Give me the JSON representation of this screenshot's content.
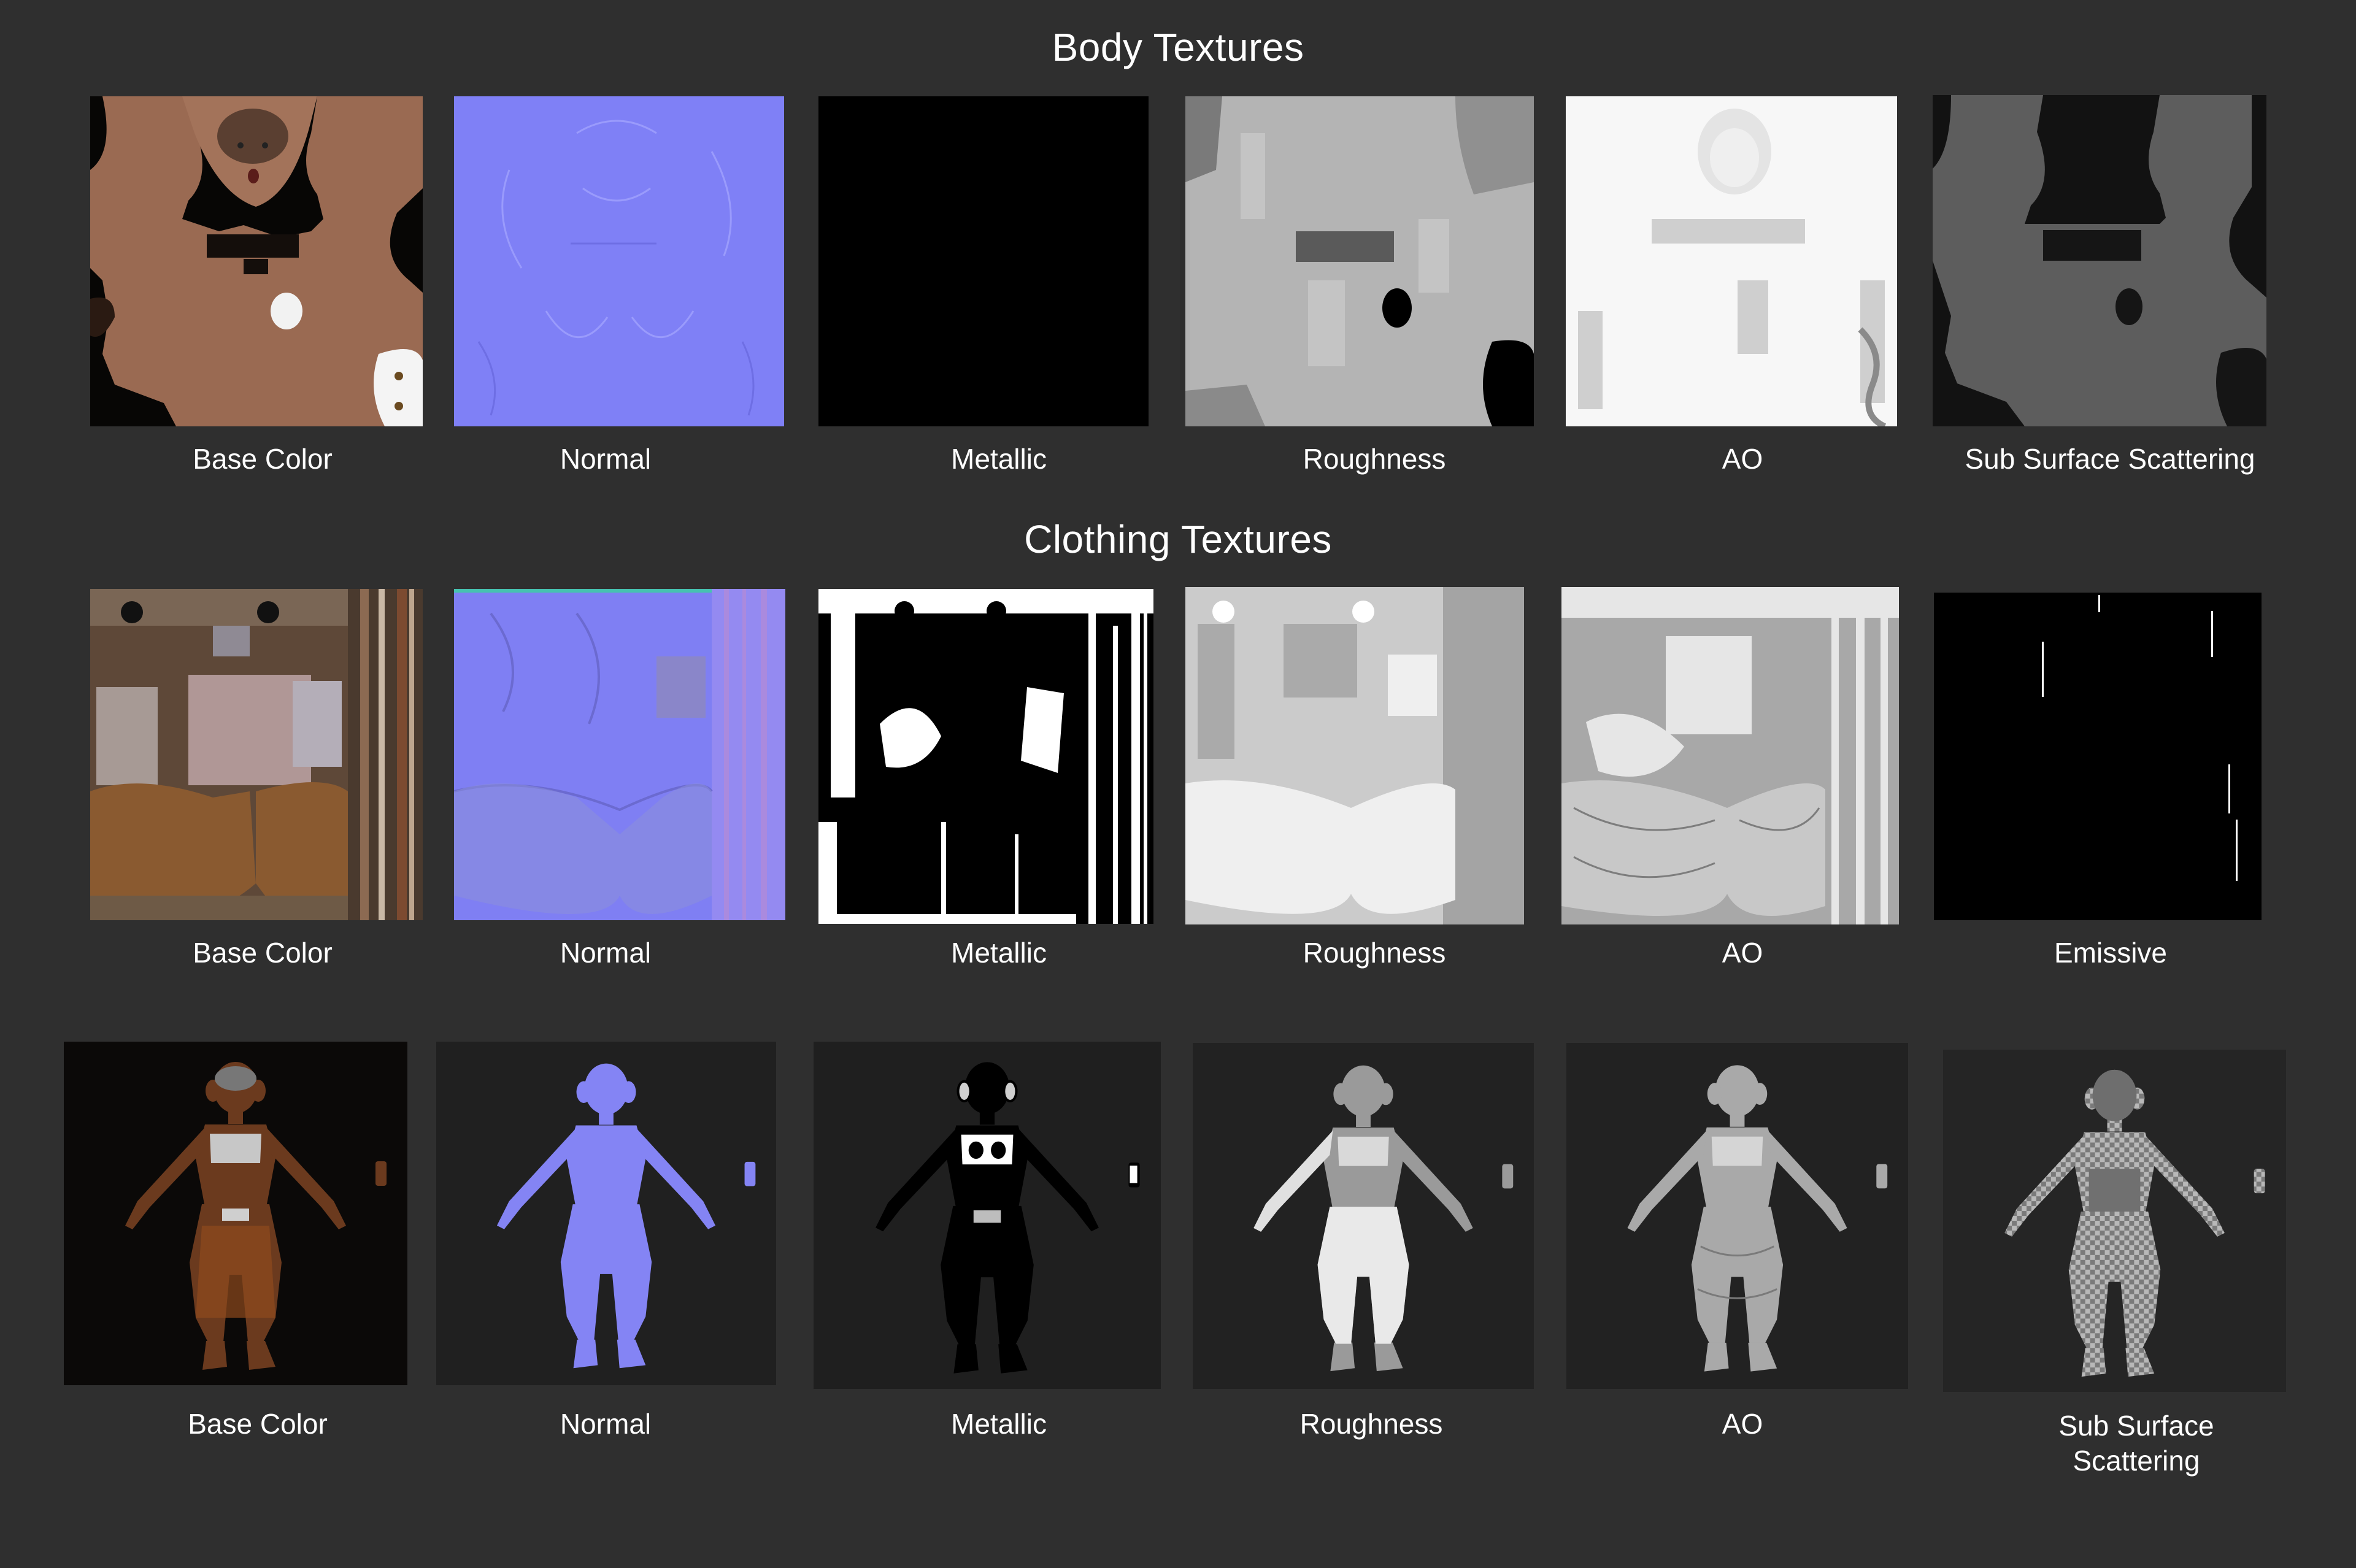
{
  "sections": {
    "body_title": "Body Textures",
    "clothing_title": "Clothing Textures"
  },
  "body_maps": [
    {
      "label": "Base Color",
      "kind": "body-base-color"
    },
    {
      "label": "Normal",
      "kind": "normal-map"
    },
    {
      "label": "Metallic",
      "kind": "black-map"
    },
    {
      "label": "Roughness",
      "kind": "grey-map"
    },
    {
      "label": "AO",
      "kind": "white-map"
    },
    {
      "label": "Sub Surface Scattering",
      "kind": "dark-grey-map"
    }
  ],
  "clothing_maps": [
    {
      "label": "Base Color",
      "kind": "cloth-base-color"
    },
    {
      "label": "Normal",
      "kind": "normal-map"
    },
    {
      "label": "Metallic",
      "kind": "bw-mask-map"
    },
    {
      "label": "Roughness",
      "kind": "light-grey-map"
    },
    {
      "label": "AO",
      "kind": "grey-map"
    },
    {
      "label": "Emissive",
      "kind": "black-map"
    }
  ],
  "render_previews": [
    {
      "label": "Base Color",
      "kind": "character-base-color"
    },
    {
      "label": "Normal",
      "kind": "character-normal"
    },
    {
      "label": "Metallic",
      "kind": "character-metallic"
    },
    {
      "label": "Roughness",
      "kind": "character-roughness"
    },
    {
      "label": "AO",
      "kind": "character-ao"
    },
    {
      "label": "Sub Surface",
      "label_line2": "Scattering",
      "kind": "character-sss"
    }
  ],
  "colors": {
    "background": "#2f2f2f",
    "skin": "#9a6a52",
    "normal_blue": "#7f7ff5",
    "render_bg_dark": "#0c0c0c",
    "render_bg": "#202020"
  }
}
